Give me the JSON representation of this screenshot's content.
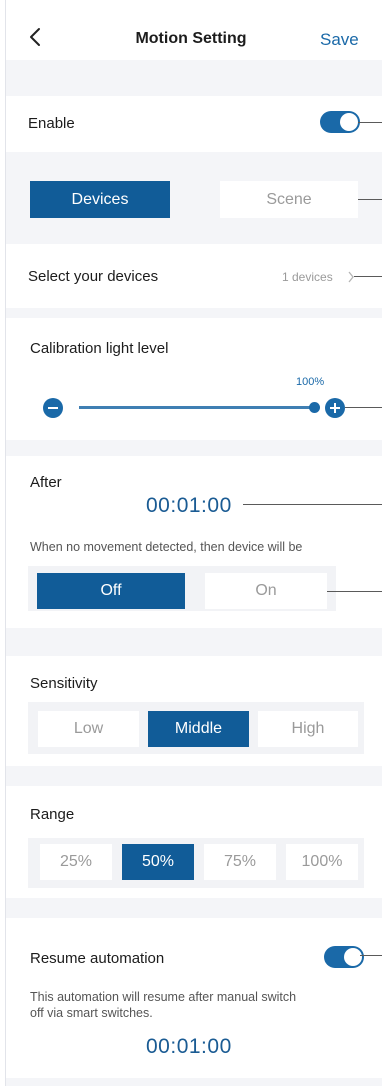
{
  "header": {
    "title": "Motion Setting",
    "save_label": "Save"
  },
  "enable": {
    "label": "Enable",
    "on": true
  },
  "target_tabs": [
    {
      "label": "Devices",
      "active": true
    },
    {
      "label": "Scene",
      "active": false
    }
  ],
  "devices": {
    "label": "Select your devices",
    "count": "1 devices"
  },
  "calibration": {
    "label": "Calibration light level",
    "value_label": "100%",
    "level": 1.0
  },
  "after": {
    "label": "After",
    "time": "00:01:00",
    "description": "When no movement detected, then device will be",
    "options": [
      {
        "label": "Off",
        "active": true
      },
      {
        "label": "On",
        "active": false
      }
    ]
  },
  "sensitivity": {
    "label": "Sensitivity",
    "options": [
      {
        "label": "Low",
        "active": false
      },
      {
        "label": "Middle",
        "active": true
      },
      {
        "label": "High",
        "active": false
      }
    ]
  },
  "range": {
    "label": "Range",
    "options": [
      {
        "label": "25%",
        "active": false
      },
      {
        "label": "50%",
        "active": true
      },
      {
        "label": "75%",
        "active": false
      },
      {
        "label": "100%",
        "active": false
      }
    ]
  },
  "resume": {
    "label": "Resume automation",
    "on": true,
    "description_line1": "This automation will resume after manual switch",
    "description_line2": "off via smart switches.",
    "time": "00:01:00"
  },
  "colors": {
    "accent": "#1a69a8",
    "accent_dark": "#115c98",
    "background": "#f4f5f8"
  }
}
